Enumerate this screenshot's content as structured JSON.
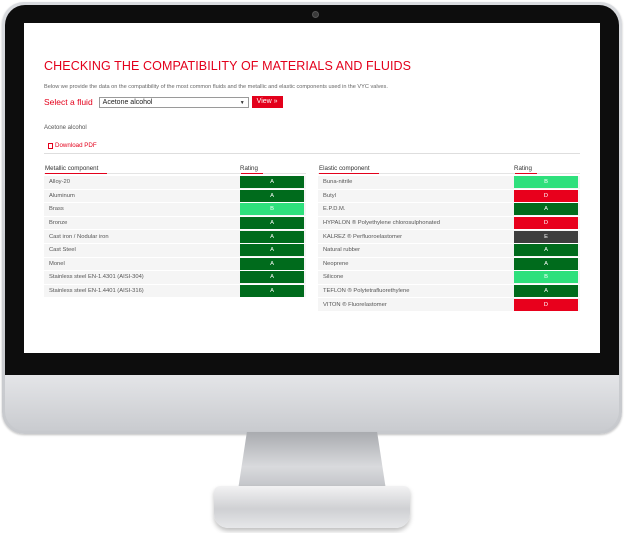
{
  "page": {
    "title": "CHECKING THE COMPATIBILITY OF MATERIALS AND FLUIDS",
    "intro": "Below we provide the data on the compatibility of the most common fluids and the metallic and elastic components used in the VYC valves."
  },
  "selector": {
    "label": "Select a fluid",
    "selected_value": "Acetone alcohol",
    "view_button": "View »"
  },
  "result": {
    "fluid_name": "Acetone alcohol",
    "download_label": "Download PDF"
  },
  "colors": {
    "A": "#006b1c",
    "B": "#2ee07c",
    "D": "#e8001c",
    "E": "#3d3d3d",
    "accent": "#e3001b"
  },
  "metallic": {
    "header_name": "Metallic component",
    "header_rating": "Rating",
    "rows": [
      {
        "name": "Alloy-20",
        "rating": "A"
      },
      {
        "name": "Aluminum",
        "rating": "A"
      },
      {
        "name": "Brass",
        "rating": "B"
      },
      {
        "name": "Bronze",
        "rating": "A"
      },
      {
        "name": "Cast iron / Nodular iron",
        "rating": "A"
      },
      {
        "name": "Cast Steel",
        "rating": "A"
      },
      {
        "name": "Monel",
        "rating": "A"
      },
      {
        "name": "Stainless steel EN-1.4301 (AISI-304)",
        "rating": "A"
      },
      {
        "name": "Stainless steel EN-1.4401 (AISI-316)",
        "rating": "A"
      }
    ]
  },
  "elastic": {
    "header_name": "Elastic component",
    "header_rating": "Rating",
    "rows": [
      {
        "name": "Buna-nitrile",
        "rating": "B"
      },
      {
        "name": "Butyl",
        "rating": "D"
      },
      {
        "name": "E.P.D.M.",
        "rating": "A"
      },
      {
        "name": "HYPALON ® Polyethylene chlorosulphonated",
        "rating": "D"
      },
      {
        "name": "KALREZ ® Perfluoroelastomer",
        "rating": "E"
      },
      {
        "name": "Natural rubber",
        "rating": "A"
      },
      {
        "name": "Neoprene",
        "rating": "A"
      },
      {
        "name": "Silicone",
        "rating": "B"
      },
      {
        "name": "TEFLON ® Polytetrafluorethylene",
        "rating": "A"
      },
      {
        "name": "VITON ® Fluorelastomer",
        "rating": "D"
      }
    ]
  }
}
